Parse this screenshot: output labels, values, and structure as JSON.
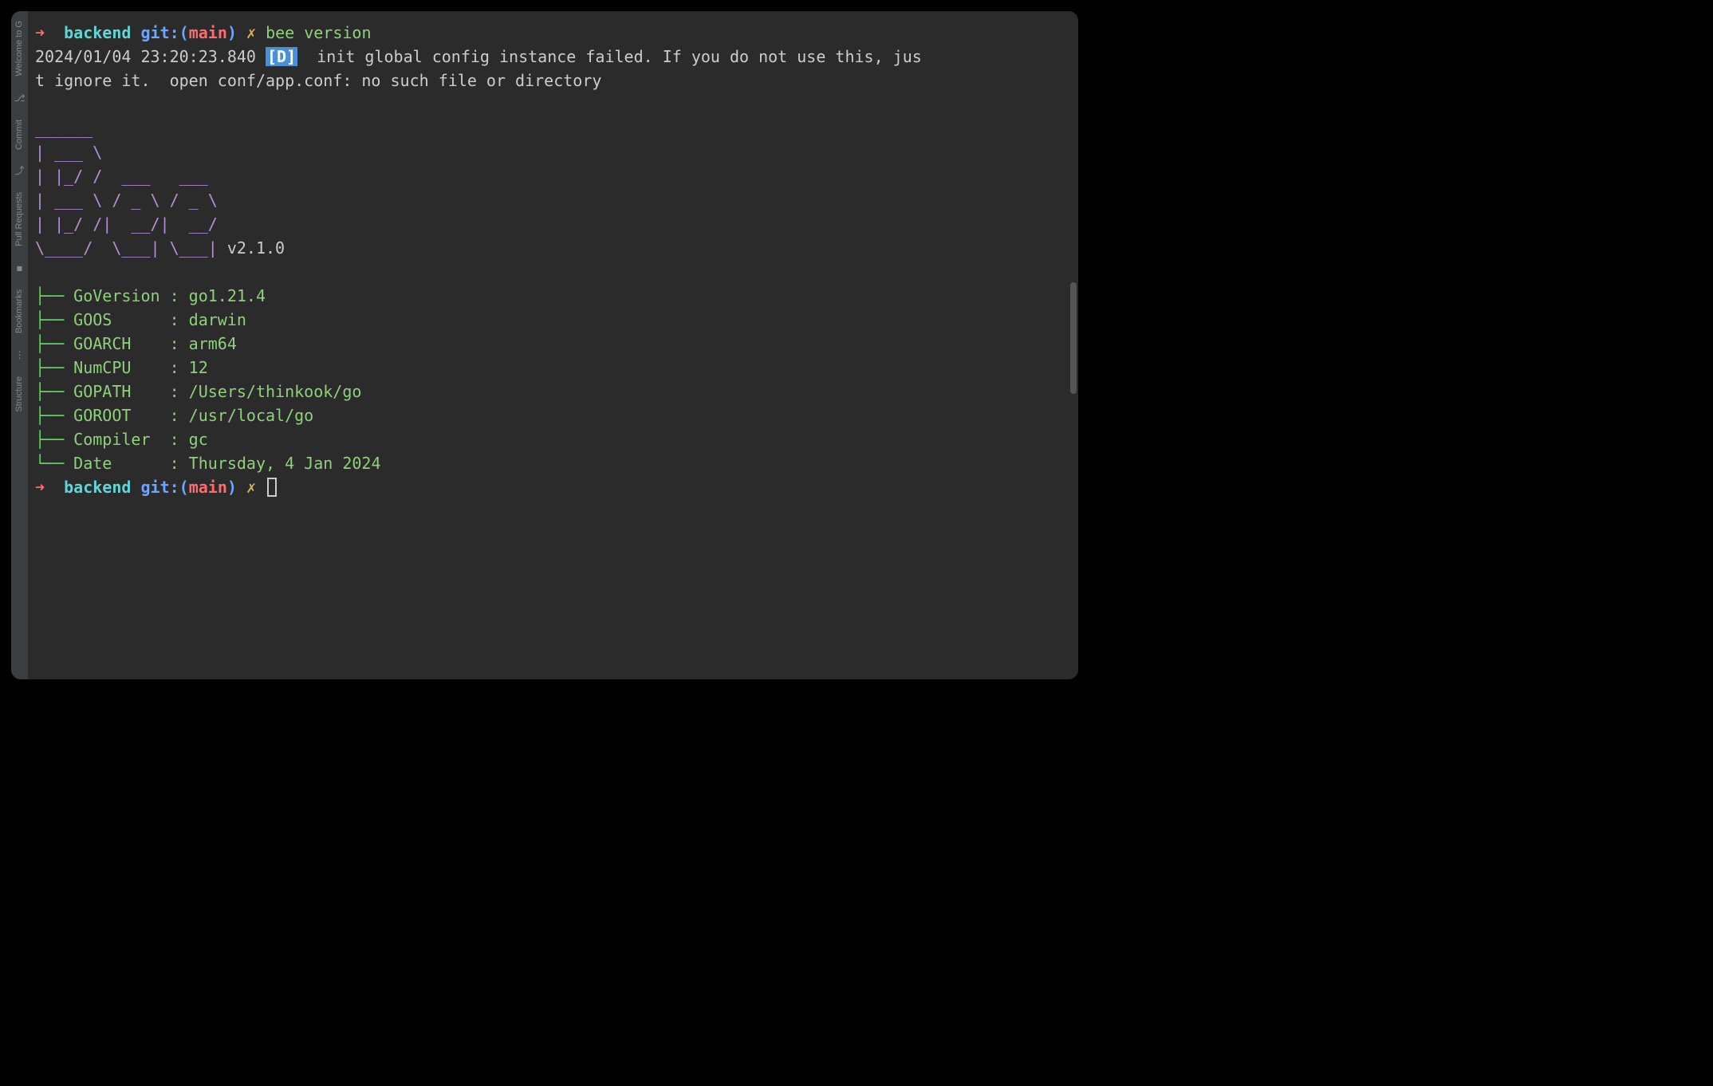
{
  "sidebar": {
    "tabs": [
      {
        "label": "Welcome to G",
        "name": "sidebar-tab-welcome"
      },
      {
        "label": "Commit",
        "name": "sidebar-tab-commit"
      },
      {
        "label": "Pull Requests",
        "name": "sidebar-tab-pullrequests"
      },
      {
        "label": "Bookmarks",
        "name": "sidebar-tab-bookmarks"
      },
      {
        "label": "Structure",
        "name": "sidebar-tab-structure"
      }
    ]
  },
  "prompt1": {
    "arrow": "➜",
    "dir": "backend",
    "git": "git:(",
    "branch": "main",
    "close": ")",
    "x": "✗",
    "command": "bee version"
  },
  "log": {
    "timestamp": "2024/01/04 23:20:23.840",
    "level": "[D]",
    "message_line1": " init global config instance failed. If you do not use this, jus",
    "message_line2": "t ignore it.  open conf/app.conf: no such file or directory"
  },
  "ascii_art": {
    "line1": "______",
    "line2": "| ___ \\",
    "line3": "| |_/ /  ___   ___",
    "line4": "| ___ \\ / _ \\ / _ \\",
    "line5": "| |_/ /|  __/|  __/",
    "line6": "\\____/  \\___| \\___|",
    "version": " v2.1.0"
  },
  "info": {
    "rows": [
      {
        "key": "GoVersion",
        "value": "go1.21.4"
      },
      {
        "key": "GOOS     ",
        "value": "darwin"
      },
      {
        "key": "GOARCH   ",
        "value": "arm64"
      },
      {
        "key": "NumCPU   ",
        "value": "12"
      },
      {
        "key": "GOPATH   ",
        "value": "/Users/thinkook/go"
      },
      {
        "key": "GOROOT   ",
        "value": "/usr/local/go"
      },
      {
        "key": "Compiler ",
        "value": "gc"
      },
      {
        "key": "Date     ",
        "value": "Thursday, 4 Jan 2024"
      }
    ],
    "branch_mid": "├──",
    "branch_last": "└──",
    "colon": " : "
  },
  "prompt2": {
    "arrow": "➜",
    "dir": "backend",
    "git": "git:(",
    "branch": "main",
    "close": ")",
    "x": "✗"
  }
}
